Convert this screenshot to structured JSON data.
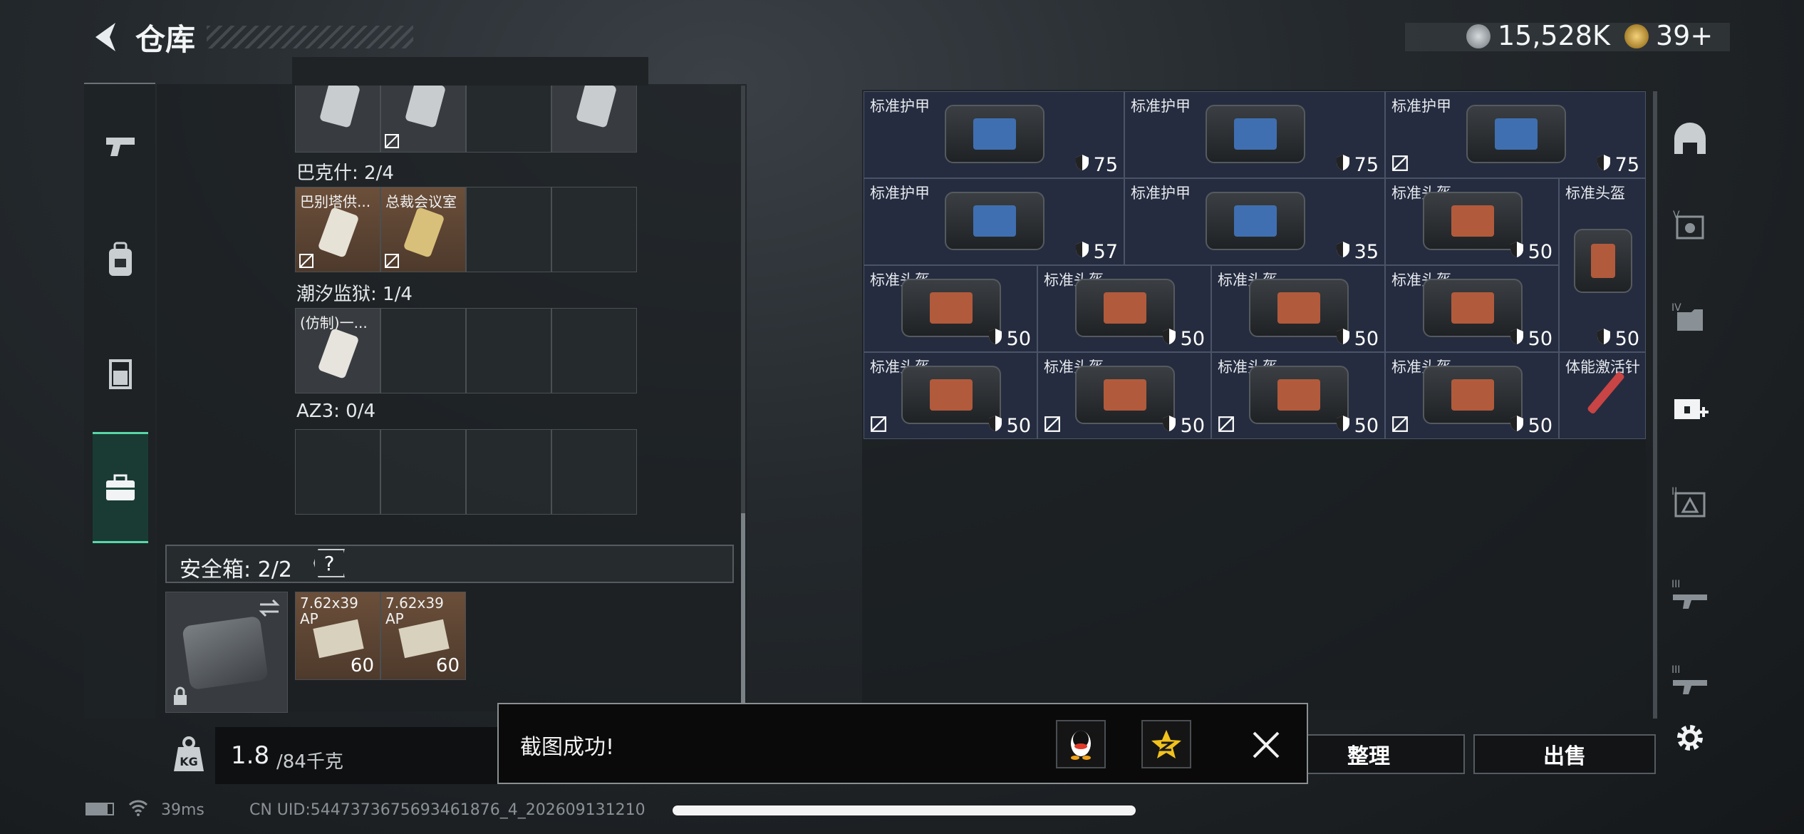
{
  "header": {
    "title": "仓库",
    "currency_amount": "15,528K",
    "premium_amount": "39+",
    "sub_text": ""
  },
  "sidebar": {
    "items": [
      "pistol-icon",
      "backpack-icon",
      "rig-icon",
      "case-icon"
    ],
    "active": 3
  },
  "container": {
    "rows": [
      {
        "label": "巴克什: 2/4"
      },
      {
        "label": "潮汐监狱: 1/4"
      },
      {
        "label": "AZ3: 0/4"
      }
    ],
    "key_items": {
      "babel": "巴别塔供...",
      "ceo": "总裁会议室",
      "replica": "(仿制)一..."
    },
    "safe_box": {
      "label": "安全箱: 2/2",
      "help": "?",
      "ammo": [
        {
          "name": "7.62x39 AP",
          "qty": "60"
        },
        {
          "name": "7.62x39 AP",
          "qty": "60"
        }
      ]
    },
    "weight": {
      "current": "1.8",
      "max": "/84千克"
    }
  },
  "stash": {
    "items": [
      {
        "name": "标准护甲",
        "value": "75",
        "locked": false
      },
      {
        "name": "标准护甲",
        "value": "75",
        "locked": false
      },
      {
        "name": "标准护甲",
        "value": "75",
        "locked": true
      },
      {
        "name": "标准护甲",
        "value": "57",
        "locked": false
      },
      {
        "name": "标准护甲",
        "value": "35",
        "locked": false
      },
      {
        "name": "标准头盔",
        "value": "50",
        "locked": false
      },
      {
        "name": "标准头盔",
        "value": "50",
        "locked": false
      },
      {
        "name": "标准头盔",
        "value": "50",
        "locked": false
      },
      {
        "name": "标准头盔",
        "value": "50",
        "locked": false
      },
      {
        "name": "标准头盔",
        "value": "50",
        "locked": false
      },
      {
        "name": "标准头盔",
        "value": "50",
        "locked": false
      },
      {
        "name": "标准头盔",
        "value": "50",
        "locked": true
      },
      {
        "name": "标准头盔",
        "value": "50",
        "locked": true
      },
      {
        "name": "标准头盔",
        "value": "50",
        "locked": true
      },
      {
        "name": "标准头盔",
        "value": "50",
        "locked": true
      },
      {
        "name": "体能激活针",
        "value": "",
        "locked": false
      }
    ],
    "buttons": {
      "sort": "整理",
      "sell": "出售"
    }
  },
  "toast": {
    "message": "截图成功!"
  },
  "status_bar": {
    "ping": "39ms",
    "uid": "CN UID:5447373675693461876_4_202609131210"
  }
}
